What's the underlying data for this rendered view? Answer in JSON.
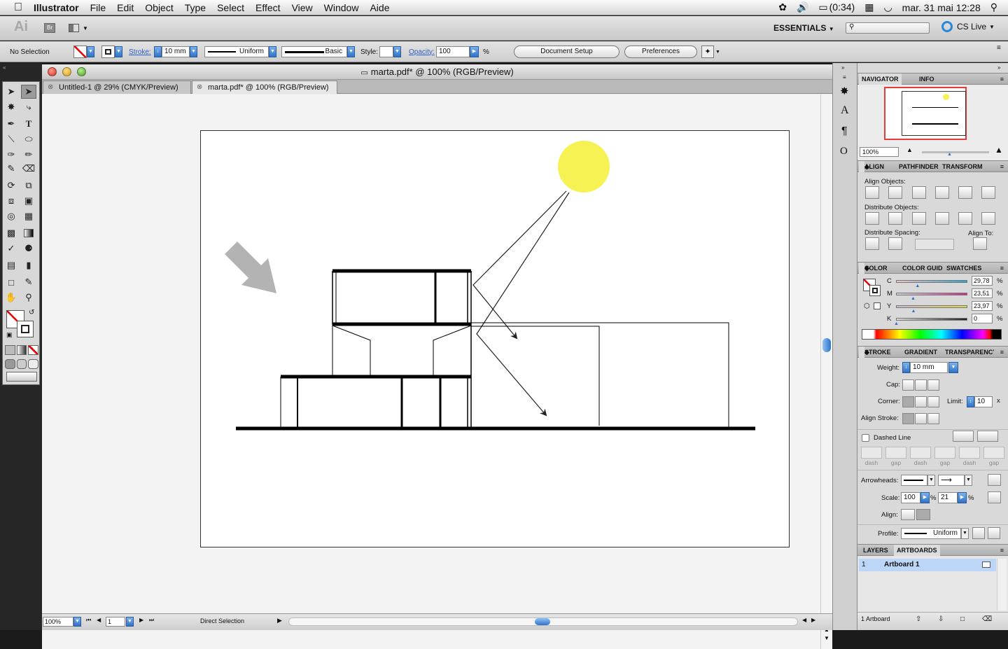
{
  "menubar": {
    "app_name": "Illustrator",
    "items": [
      "File",
      "Edit",
      "Object",
      "Type",
      "Select",
      "Effect",
      "View",
      "Window",
      "Aide"
    ],
    "battery": "(0:34)",
    "datetime": "mar. 31 mai  12:28"
  },
  "appbar": {
    "logo": "Ai",
    "bridge": "Br",
    "workspace": "ESSENTIALS",
    "cs_live": "CS Live"
  },
  "control": {
    "selection": "No Selection",
    "stroke_label": "Stroke:",
    "stroke_value": "10 mm",
    "profile_value": "Uniform",
    "brush_value": "Basic",
    "style_label": "Style:",
    "opacity_label": "Opacity:",
    "opacity_value": "100",
    "opacity_unit": "%",
    "document_setup": "Document Setup",
    "preferences": "Preferences"
  },
  "document": {
    "title": "marta.pdf* @ 100% (RGB/Preview)",
    "tabs": [
      {
        "label": "Untitled-1 @ 29% (CMYK/Preview)",
        "active": false
      },
      {
        "label": "marta.pdf* @ 100% (RGB/Preview)",
        "active": true
      }
    ],
    "zoom": "100%",
    "artboard_number": "1",
    "status_tool": "Direct Selection"
  },
  "panels": {
    "navigator": {
      "tabs": [
        "NAVIGATOR",
        "INFO"
      ],
      "zoom": "100%"
    },
    "align": {
      "tabs": [
        "ALIGN",
        "PATHFINDER",
        "TRANSFORM"
      ],
      "align_objects": "Align Objects:",
      "distribute_objects": "Distribute Objects:",
      "distribute_spacing": "Distribute Spacing:",
      "align_to": "Align To:"
    },
    "color": {
      "tabs": [
        "COLOR",
        "COLOR GUIDE",
        "SWATCHES"
      ],
      "channels": [
        {
          "name": "C",
          "value": "29,78",
          "level": 0.2978,
          "color": "#23a9d6"
        },
        {
          "name": "M",
          "value": "23,51",
          "level": 0.2351,
          "color": "#d6278f"
        },
        {
          "name": "Y",
          "value": "23,97",
          "level": 0.2397,
          "color": "#e3d93b"
        },
        {
          "name": "K",
          "value": "0",
          "level": 0,
          "color": "#222222"
        }
      ],
      "unit": "%"
    },
    "stroke": {
      "tabs": [
        "STROKE",
        "GRADIENT",
        "TRANSPARENCY"
      ],
      "weight_label": "Weight:",
      "weight_value": "10 mm",
      "cap_label": "Cap:",
      "corner_label": "Corner:",
      "limit_label": "Limit:",
      "limit_value": "10",
      "limit_unit": "x",
      "align_stroke_label": "Align Stroke:",
      "dashed_line_label": "Dashed Line",
      "dash_labels": [
        "dash",
        "gap",
        "dash",
        "gap",
        "dash",
        "gap"
      ],
      "arrowheads_label": "Arrowheads:",
      "scale_label": "Scale:",
      "scale_start": "100",
      "scale_end": "21",
      "scale_unit": "%",
      "align_label": "Align:",
      "profile_label": "Profile:",
      "profile_value": "Uniform"
    },
    "layers": {
      "tabs": [
        "LAYERS",
        "ARTBOARDS"
      ],
      "rows": [
        {
          "index": "1",
          "name": "Artboard 1"
        }
      ],
      "footer": "1 Artboard"
    }
  },
  "colors": {
    "sun": "#f6f253",
    "arrow_gray": "#b3b3b3",
    "selection_blue": "#bcd6f7",
    "accent_blue": "#2f72c7"
  }
}
